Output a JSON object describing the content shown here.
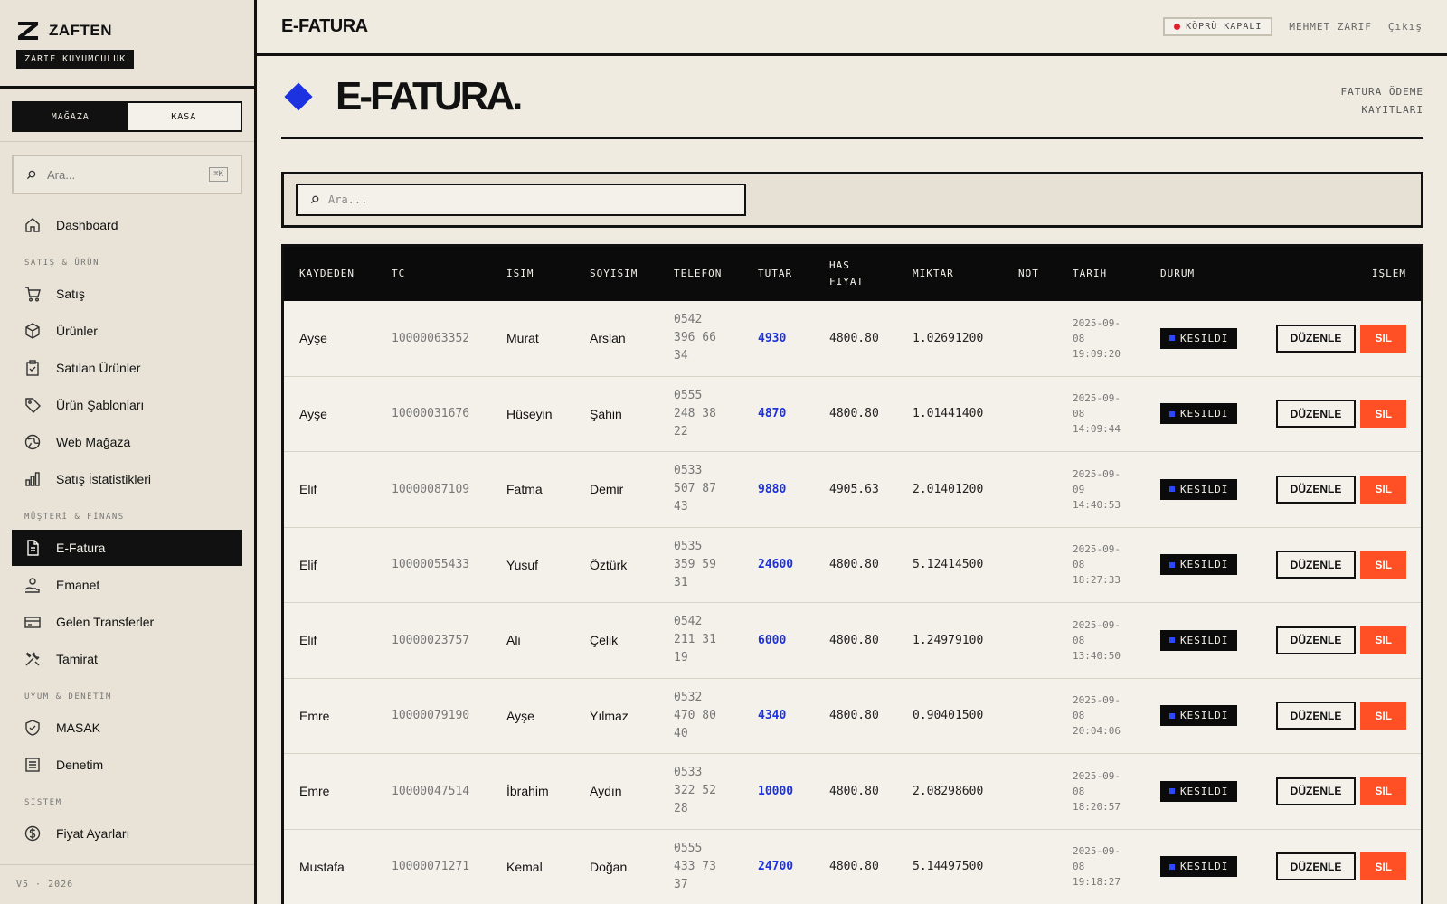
{
  "brand": {
    "name": "ZAFTEN",
    "subtitle": "ZARIF KUYUMCULUK"
  },
  "mode_toggle": {
    "store": "MAĞAZA",
    "register": "KASA",
    "active": "store"
  },
  "sidebar_search": {
    "placeholder": "Ara...",
    "shortcut": "⌘K"
  },
  "nav": {
    "dashboard": "Dashboard",
    "section_sales": "SATIŞ & ÜRÜN",
    "sales": "Satış",
    "products": "Ürünler",
    "sold_products": "Satılan Ürünler",
    "product_templates": "Ürün Şablonları",
    "web_store": "Web Mağaza",
    "sales_stats": "Satış İstatistikleri",
    "section_finance": "MÜŞTERİ & FİNANS",
    "e_invoice": "E-Fatura",
    "escrow": "Emanet",
    "incoming_transfers": "Gelen Transferler",
    "repair": "Tamirat",
    "section_compliance": "UYUM & DENETİM",
    "masak": "MASAK",
    "audit": "Denetim",
    "section_system": "SİSTEM",
    "price_settings": "Fiyat Ayarları"
  },
  "version": "V5 · 2026",
  "topbar": {
    "title": "E-FATURA",
    "bridge_status": "KÖPRÜ KAPALI",
    "user": "MEHMET ZARIF",
    "logout": "Çıkış"
  },
  "page": {
    "title": "E-FATURA.",
    "subtitle_line1": "FATURA ÖDEME",
    "subtitle_line2": "KAYITLARI"
  },
  "filter": {
    "placeholder": "Ara..."
  },
  "table": {
    "headers": {
      "recorder": "KAYDEDEN",
      "tc": "TC",
      "name": "İSIM",
      "surname": "SOYISIM",
      "phone": "TELEFON",
      "amount": "TUTAR",
      "has_price_1": "HAS",
      "has_price_2": "FIYAT",
      "quantity": "MIKTAR",
      "note": "NOT",
      "date": "TARIH",
      "status": "DURUM",
      "action": "İŞLEM"
    },
    "edit_label": "DÜZENLE",
    "delete_label": "SIL",
    "rows": [
      {
        "recorder": "Ayşe",
        "tc": "10000063352",
        "name": "Murat",
        "surname": "Arslan",
        "phone_1": "0542",
        "phone_2": "396 66",
        "phone_3": "34",
        "amount": "4930",
        "has_price": "4800.80",
        "quantity": "1.02691200",
        "note": "",
        "date_1": "2025-09-",
        "date_2": "08",
        "date_3": "19:09:20",
        "status": "KESILDI"
      },
      {
        "recorder": "Ayşe",
        "tc": "10000031676",
        "name": "Hüseyin",
        "surname": "Şahin",
        "phone_1": "0555",
        "phone_2": "248 38",
        "phone_3": "22",
        "amount": "4870",
        "has_price": "4800.80",
        "quantity": "1.01441400",
        "note": "",
        "date_1": "2025-09-",
        "date_2": "08",
        "date_3": "14:09:44",
        "status": "KESILDI"
      },
      {
        "recorder": "Elif",
        "tc": "10000087109",
        "name": "Fatma",
        "surname": "Demir",
        "phone_1": "0533",
        "phone_2": "507 87",
        "phone_3": "43",
        "amount": "9880",
        "has_price": "4905.63",
        "quantity": "2.01401200",
        "note": "",
        "date_1": "2025-09-",
        "date_2": "09",
        "date_3": "14:40:53",
        "status": "KESILDI"
      },
      {
        "recorder": "Elif",
        "tc": "10000055433",
        "name": "Yusuf",
        "surname": "Öztürk",
        "phone_1": "0535",
        "phone_2": "359 59",
        "phone_3": "31",
        "amount": "24600",
        "has_price": "4800.80",
        "quantity": "5.12414500",
        "note": "",
        "date_1": "2025-09-",
        "date_2": "08",
        "date_3": "18:27:33",
        "status": "KESILDI"
      },
      {
        "recorder": "Elif",
        "tc": "10000023757",
        "name": "Ali",
        "surname": "Çelik",
        "phone_1": "0542",
        "phone_2": "211 31",
        "phone_3": "19",
        "amount": "6000",
        "has_price": "4800.80",
        "quantity": "1.24979100",
        "note": "",
        "date_1": "2025-09-",
        "date_2": "08",
        "date_3": "13:40:50",
        "status": "KESILDI"
      },
      {
        "recorder": "Emre",
        "tc": "10000079190",
        "name": "Ayşe",
        "surname": "Yılmaz",
        "phone_1": "0532",
        "phone_2": "470 80",
        "phone_3": "40",
        "amount": "4340",
        "has_price": "4800.80",
        "quantity": "0.90401500",
        "note": "",
        "date_1": "2025-09-",
        "date_2": "08",
        "date_3": "20:04:06",
        "status": "KESILDI"
      },
      {
        "recorder": "Emre",
        "tc": "10000047514",
        "name": "İbrahim",
        "surname": "Aydın",
        "phone_1": "0533",
        "phone_2": "322 52",
        "phone_3": "28",
        "amount": "10000",
        "has_price": "4800.80",
        "quantity": "2.08298600",
        "note": "",
        "date_1": "2025-09-",
        "date_2": "08",
        "date_3": "18:20:57",
        "status": "KESILDI"
      },
      {
        "recorder": "Mustafa",
        "tc": "10000071271",
        "name": "Kemal",
        "surname": "Doğan",
        "phone_1": "0555",
        "phone_2": "433 73",
        "phone_3": "37",
        "amount": "24700",
        "has_price": "4800.80",
        "quantity": "5.14497500",
        "note": "",
        "date_1": "2025-09-",
        "date_2": "08",
        "date_3": "19:18:27",
        "status": "KESILDI"
      }
    ]
  },
  "colors": {
    "accent": "#1c31e0",
    "danger": "#ff4f24",
    "status_dot": "#e01f2a",
    "ink": "#111111",
    "paper": "#efebe1"
  }
}
